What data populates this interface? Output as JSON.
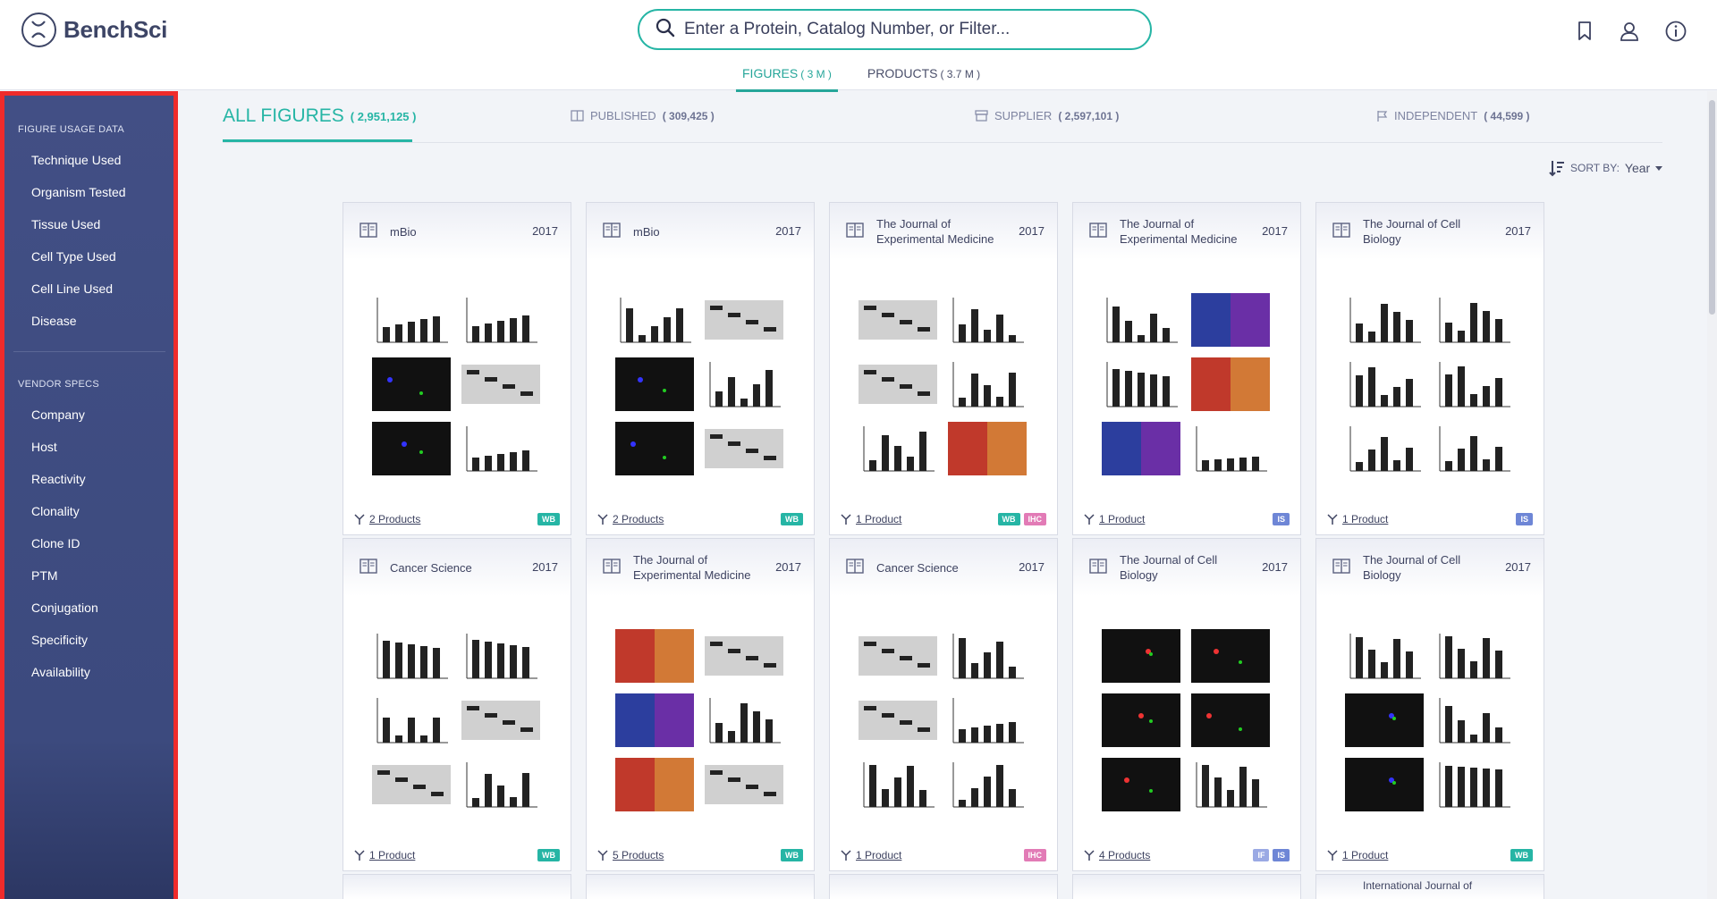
{
  "header": {
    "brand": "BenchSci",
    "search_placeholder": "Enter a Protein, Catalog Number, or Filter...",
    "tabs": [
      {
        "label": "FIGURES",
        "count": "( 3 M )",
        "active": true
      },
      {
        "label": "PRODUCTS",
        "count": "( 3.7 M )",
        "active": false
      }
    ]
  },
  "sidebar": {
    "section1_title": "FIGURE USAGE DATA",
    "section1_items": [
      "Technique Used",
      "Organism Tested",
      "Tissue Used",
      "Cell Type Used",
      "Cell Line Used",
      "Disease"
    ],
    "section2_title": "VENDOR SPECS",
    "section2_items": [
      "Company",
      "Host",
      "Reactivity",
      "Clonality",
      "Clone ID",
      "PTM",
      "Conjugation",
      "Specificity",
      "Availability"
    ]
  },
  "filters": {
    "all": {
      "label": "ALL FIGURES",
      "count": "( 2,951,125 )"
    },
    "published": {
      "label": "PUBLISHED",
      "count": "( 309,425 )"
    },
    "supplier": {
      "label": "SUPPLIER",
      "count": "( 2,597,101 )"
    },
    "independent": {
      "label": "INDEPENDENT",
      "count": "( 44,599 )"
    }
  },
  "sort": {
    "label": "SORT BY:",
    "value": "Year"
  },
  "cards": [
    {
      "journal": "mBio",
      "year": "2017",
      "products": "2 Products",
      "badges": [
        "WB"
      ]
    },
    {
      "journal": "mBio",
      "year": "2017",
      "products": "2 Products",
      "badges": [
        "WB"
      ]
    },
    {
      "journal": "The Journal of Experimental Medicine",
      "year": "2017",
      "products": "1 Product",
      "badges": [
        "WB",
        "IHC"
      ]
    },
    {
      "journal": "The Journal of Experimental Medicine",
      "year": "2017",
      "products": "1 Product",
      "badges": [
        "IS"
      ]
    },
    {
      "journal": "The Journal of Cell Biology",
      "year": "2017",
      "products": "1 Product",
      "badges": [
        "IS"
      ]
    },
    {
      "journal": "Cancer Science",
      "year": "2017",
      "products": "1 Product",
      "badges": [
        "WB"
      ]
    },
    {
      "journal": "The Journal of Experimental Medicine",
      "year": "2017",
      "products": "5 Products",
      "badges": [
        "WB"
      ]
    },
    {
      "journal": "Cancer Science",
      "year": "2017",
      "products": "1 Product",
      "badges": [
        "IHC"
      ]
    },
    {
      "journal": "The Journal of Cell Biology",
      "year": "2017",
      "products": "4 Products",
      "badges": [
        "IF",
        "IS"
      ]
    },
    {
      "journal": "The Journal of Cell Biology",
      "year": "2017",
      "products": "1 Product",
      "badges": [
        "WB"
      ]
    }
  ],
  "partial_cards": [
    "",
    "",
    "",
    "",
    "International Journal of"
  ],
  "colors": {
    "accent": "#26b5a5",
    "sidebar": "#424f85",
    "highlight_border": "#ef2b2b"
  }
}
